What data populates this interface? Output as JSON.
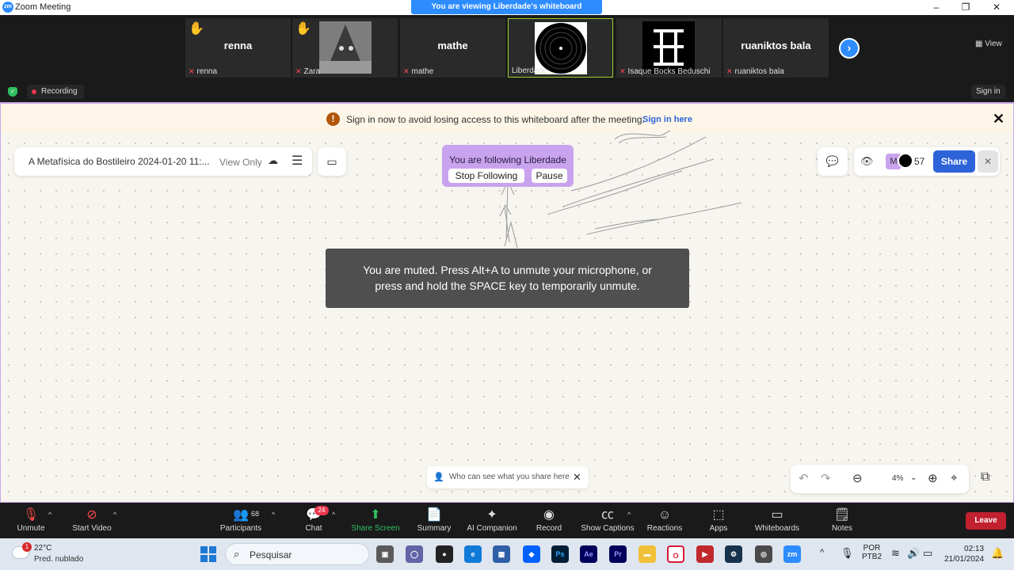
{
  "titlebar": {
    "logo": "zm",
    "title": "Zoom Meeting",
    "banner": "You are viewing Liberdade's whiteboard",
    "minimize": "–",
    "maximize": "❐",
    "close": "✕"
  },
  "participants_strip": [
    {
      "big_name": "renna",
      "label": "renna",
      "hand": true
    },
    {
      "big_name": "",
      "label": "Zara",
      "hand": true
    },
    {
      "big_name": "mathe",
      "label": "mathe",
      "hand": false
    },
    {
      "big_name": "",
      "label": "Liberdade",
      "hand": false
    },
    {
      "big_name": "",
      "label": "Isaque Bocks Beduschi",
      "hand": false
    },
    {
      "big_name": "ruaniktos bala",
      "label": "ruaniktos bala",
      "hand": false
    }
  ],
  "strip_controls": {
    "next": "›",
    "view": "View"
  },
  "status_row": {
    "recording": "Recording",
    "sign_in": "Sign in"
  },
  "warning": {
    "icon": "!",
    "text": "Sign in now to avoid losing access to this whiteboard after the meeting.",
    "link": "Sign in here",
    "close": "✕"
  },
  "doc_panel": {
    "title": "A Metafísica do Bostileiro 2024-01-20 11:...",
    "view_only": "View Only"
  },
  "follow": {
    "text": "You are following Liberdade",
    "stop": "Stop Following",
    "pause": "Pause"
  },
  "share_panel": {
    "avatar_letter": "M",
    "count": "57",
    "share": "Share",
    "close": "✕"
  },
  "mute_toast": {
    "line1": "You are muted. Press Alt+A to unmute your microphone, or",
    "line2": "press and hold the SPACE key to temporarily unmute."
  },
  "who_can_see": {
    "text": "Who can see what you share here",
    "close": "✕"
  },
  "zoom_panel": {
    "level": "4%"
  },
  "controls": {
    "unmute": "Unmute",
    "start_video": "Start Video",
    "participants": "Participants",
    "participants_count": "68",
    "chat": "Chat",
    "chat_badge": "24",
    "share_screen": "Share Screen",
    "summary": "Summary",
    "ai_companion": "AI Companion",
    "record": "Record",
    "show_captions": "Show Captions",
    "reactions": "Reactions",
    "apps": "Apps",
    "whiteboards": "Whiteboards",
    "notes": "Notes",
    "leave": "Leave"
  },
  "taskbar": {
    "weather_badge": "1",
    "temp": "22°C",
    "weather_desc": "Pred. nublado",
    "search_placeholder": "Pesquisar",
    "lang1": "POR",
    "lang2": "PTB2",
    "time": "02:13",
    "date": "21/01/2024"
  },
  "colors": {
    "zoom_blue": "#2d8cff",
    "follow_purple": "#c9a3ee",
    "share_blue": "#2d63d8",
    "leave_red": "#c1202f",
    "whiteboard_bg": "#f7f5ef"
  }
}
